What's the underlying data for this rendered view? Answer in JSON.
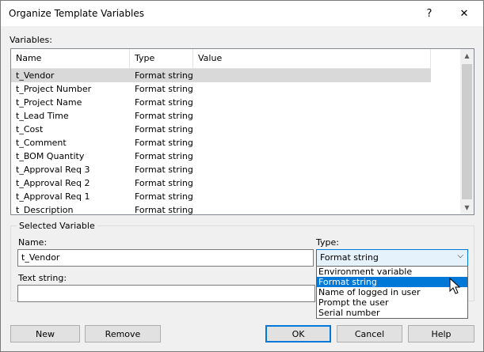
{
  "window": {
    "title": "Organize Template Variables",
    "help_glyph": "?",
    "close_glyph": "✕"
  },
  "variables_label": "Variables:",
  "columns": {
    "name": "Name",
    "type": "Type",
    "value": "Value"
  },
  "rows": [
    {
      "name": "t_Vendor",
      "type": "Format string",
      "value": ""
    },
    {
      "name": "t_Project Number",
      "type": "Format string",
      "value": ""
    },
    {
      "name": "t_Project Name",
      "type": "Format string",
      "value": ""
    },
    {
      "name": "t_Lead Time",
      "type": "Format string",
      "value": ""
    },
    {
      "name": "t_Cost",
      "type": "Format string",
      "value": ""
    },
    {
      "name": "t_Comment",
      "type": "Format string",
      "value": ""
    },
    {
      "name": "t_BOM Quantity",
      "type": "Format string",
      "value": ""
    },
    {
      "name": "t_Approval Req 3",
      "type": "Format string",
      "value": ""
    },
    {
      "name": "t_Approval Req 2",
      "type": "Format string",
      "value": ""
    },
    {
      "name": "t_Approval Req 1",
      "type": "Format string",
      "value": ""
    },
    {
      "name": "t_Description",
      "type": "Format string",
      "value": ""
    }
  ],
  "selected_variable": {
    "group_title": "Selected Variable",
    "name_label": "Name:",
    "name_value": "t_Vendor",
    "type_label": "Type:",
    "type_value": "Format string",
    "text_string_label": "Text string:",
    "text_string_value": ""
  },
  "type_options": [
    "Environment variable",
    "Format string",
    "Name of logged in user",
    "Prompt the user",
    "Serial number"
  ],
  "buttons": {
    "new": "New",
    "remove": "Remove",
    "ok": "OK",
    "cancel": "Cancel",
    "help": "Help"
  },
  "colors": {
    "accent": "#0078d7",
    "selection_gray": "#d9d9d9"
  }
}
